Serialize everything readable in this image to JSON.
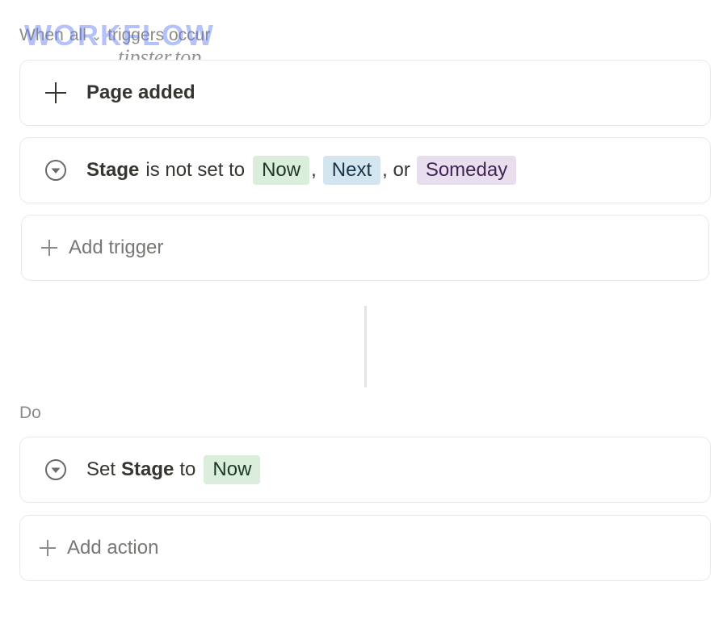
{
  "trigger_header": {
    "prefix": "When",
    "mode": "all",
    "suffix": "triggers occur"
  },
  "watermark": {
    "logo": "WORKFLOW",
    "text": "tipster.top"
  },
  "triggers": [
    {
      "icon": "plus-icon",
      "label": "Page added"
    },
    {
      "icon": "filter-circle-icon",
      "property": "Stage",
      "condition": "is not set to",
      "values": [
        {
          "label": "Now",
          "color": "#dbeddb"
        },
        {
          "label": "Next",
          "color": "#d3e5ef"
        },
        {
          "label": "Someday",
          "color": "#e8deee"
        }
      ],
      "sep1": ",",
      "sep2": ", or"
    }
  ],
  "add_trigger_label": "Add trigger",
  "do_label": "Do",
  "actions": [
    {
      "icon": "filter-circle-icon",
      "verb": "Set",
      "property": "Stage",
      "preposition": "to",
      "value": {
        "label": "Now",
        "color": "#dbeddb"
      }
    }
  ],
  "add_action_label": "Add action"
}
